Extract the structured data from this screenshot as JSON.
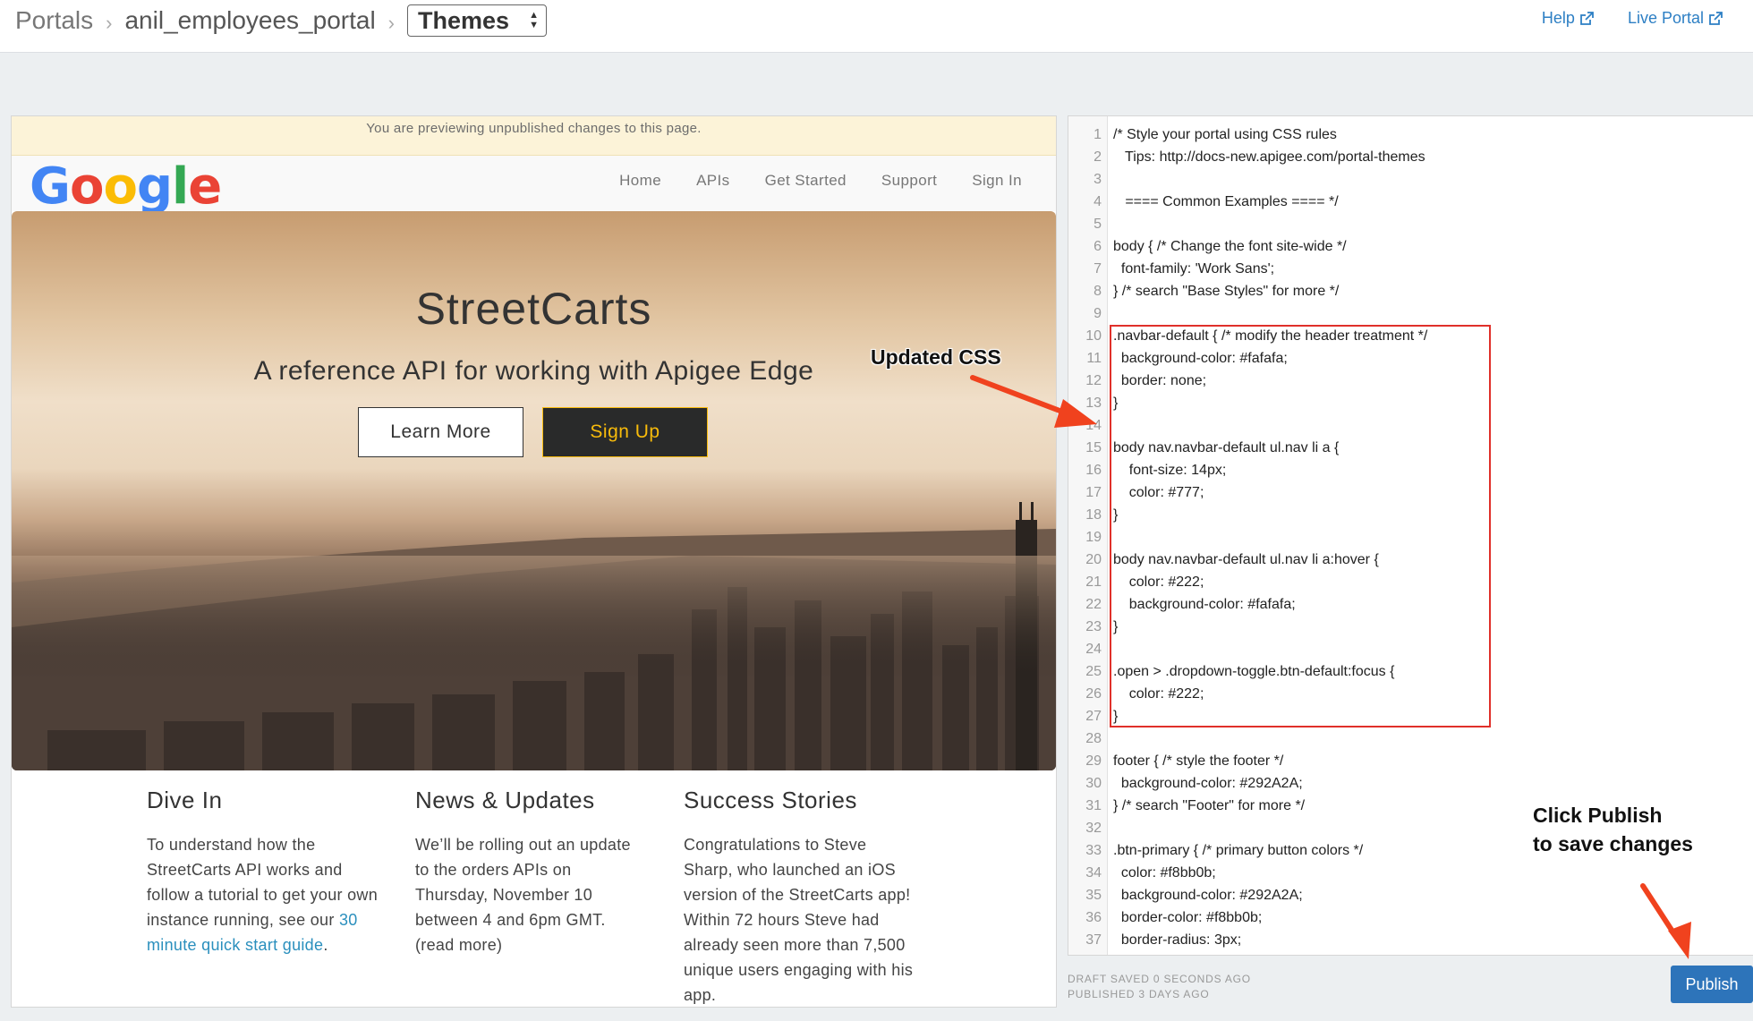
{
  "breadcrumb": {
    "portals": "Portals",
    "portal_name": "anil_employees_portal",
    "section": "Themes"
  },
  "toplinks": {
    "help": "Help",
    "live_portal": "Live Portal"
  },
  "preview": {
    "banner": "You are previewing unpublished changes to this page.",
    "logo_letters": [
      "G",
      "o",
      "o",
      "g",
      "l",
      "e"
    ],
    "logo_colors": [
      "#4285F4",
      "#EA4335",
      "#FBBC05",
      "#4285F4",
      "#34A853",
      "#EA4335"
    ],
    "nav": [
      "Home",
      "APIs",
      "Get Started",
      "Support",
      "Sign In"
    ],
    "hero_title": "StreetCarts",
    "hero_subtitle": "A reference API for working with Apigee Edge",
    "learn_more": "Learn More",
    "sign_up": "Sign Up",
    "columns": [
      {
        "title": "Dive In",
        "text_before": "To understand how the StreetCarts API works and follow a tutorial to get your own instance running, see our ",
        "link": "30 minute quick start guide",
        "text_after": "."
      },
      {
        "title": "News & Updates",
        "text": "We’ll be rolling out an update to the orders APIs on Thursday, November 10 between 4 and 6pm GMT. (read more)"
      },
      {
        "title": "Success Stories",
        "text": "Congratulations to Steve Sharp, who launched an iOS version of the StreetCarts app! Within 72 hours Steve had already seen more than 7,500 unique users engaging with his app."
      }
    ]
  },
  "editor": {
    "line_numbers": [
      "1",
      "2",
      "3",
      "4",
      "5",
      "6",
      "7",
      "8",
      "9",
      "10",
      "11",
      "12",
      "13",
      "14",
      "15",
      "16",
      "17",
      "18",
      "19",
      "20",
      "21",
      "22",
      "23",
      "24",
      "25",
      "26",
      "27",
      "28",
      "29",
      "30",
      "31",
      "32",
      "33",
      "34",
      "35",
      "36",
      "37"
    ],
    "lines": [
      "/* Style your portal using CSS rules",
      "   Tips: http://docs-new.apigee.com/portal-themes",
      "",
      "   ==== Common Examples ==== */",
      "",
      "body { /* Change the font site-wide */",
      "  font-family: 'Work Sans';",
      "} /* search \"Base Styles\" for more */",
      "",
      ".navbar-default { /* modify the header treatment */",
      "  background-color: #fafafa;",
      "  border: none;",
      "}",
      "",
      "body nav.navbar-default ul.nav li a {",
      "    font-size: 14px;",
      "    color: #777;",
      "}",
      "",
      "body nav.navbar-default ul.nav li a:hover {",
      "    color: #222;",
      "    background-color: #fafafa;",
      "}",
      "",
      ".open > .dropdown-toggle.btn-default:focus {",
      "    color: #222;",
      "}",
      "",
      "footer { /* style the footer */",
      "  background-color: #292A2A;",
      "} /* search \"Footer\" for more */",
      "",
      ".btn-primary { /* primary button colors */",
      "  color: #f8bb0b;",
      "  background-color: #292A2A;",
      "  border-color: #f8bb0b;",
      "  border-radius: 3px;"
    ]
  },
  "status": {
    "draft": "DRAFT SAVED 0 SECONDS AGO",
    "published": "PUBLISHED 3 DAYS AGO"
  },
  "publish_label": "Publish",
  "annotations": {
    "updated_css": "Updated CSS",
    "click_publish_1": "Click Publish",
    "click_publish_2": "to save changes"
  },
  "colors": {
    "accent_blue": "#2d74ba",
    "annotation_red": "#e0302a",
    "signup_yellow": "#f8bb0b",
    "dark_button": "#292a2a"
  }
}
